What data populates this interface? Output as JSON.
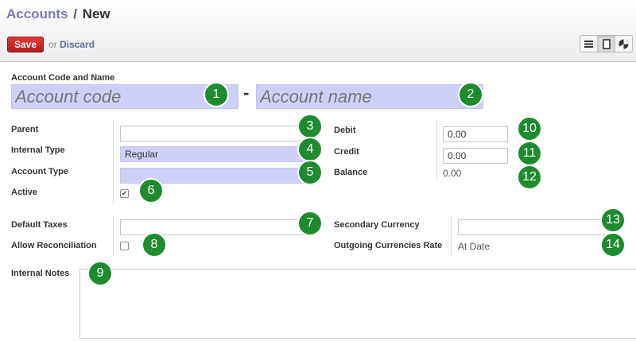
{
  "breadcrumb": {
    "parent": "Accounts",
    "separator": "/",
    "current": "New"
  },
  "actions": {
    "save_label": "Save",
    "or_text": "or",
    "discard_label": "Discard"
  },
  "view_switcher": [
    "list-view-icon",
    "form-view-icon",
    "graph-view-icon"
  ],
  "form": {
    "header_label": "Account Code and Name",
    "code_placeholder": "Account code",
    "name_placeholder": "Account name",
    "dash": "-",
    "parent_label": "Parent",
    "parent_value": "",
    "internal_type_label": "Internal Type",
    "internal_type_value": "Regular",
    "account_type_label": "Account Type",
    "account_type_value": "",
    "active_label": "Active",
    "active_checked": true,
    "active_check_glyph": "✔",
    "debit_label": "Debit",
    "debit_value": "0.00",
    "credit_label": "Credit",
    "credit_value": "0.00",
    "balance_label": "Balance",
    "balance_value": "0.00",
    "default_taxes_label": "Default Taxes",
    "default_taxes_value": "",
    "allow_reconciliation_label": "Allow Reconciliation",
    "allow_reconciliation_checked": false,
    "secondary_currency_label": "Secondary Currency",
    "secondary_currency_value": "",
    "outgoing_rate_label": "Outgoing Currencies Rate",
    "outgoing_rate_value": "At Date",
    "internal_notes_label": "Internal Notes"
  },
  "markers": [
    "1",
    "2",
    "3",
    "4",
    "5",
    "6",
    "7",
    "8",
    "9",
    "10",
    "11",
    "12",
    "13",
    "14"
  ],
  "colors": {
    "accent_green": "#1e8c2e",
    "save_red": "#c62828",
    "required_bg": "#cfd0fa",
    "link": "#7c7bad"
  }
}
